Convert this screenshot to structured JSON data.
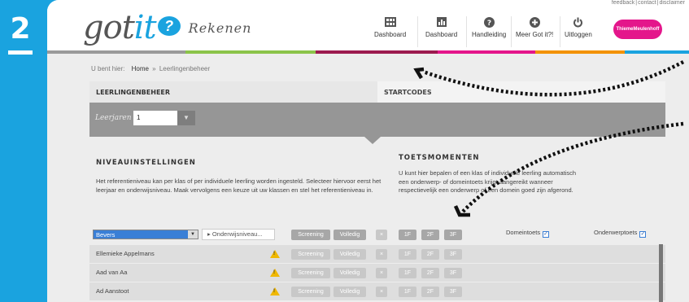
{
  "step": {
    "number": "2"
  },
  "app": {
    "logo_main": "got",
    "logo_it": "it",
    "logo_badge": "?",
    "logo_sub": "Rekenen",
    "publisher": "ThiemeMeulenhoff"
  },
  "toplinks": [
    "feedback",
    "contact",
    "disclaimer"
  ],
  "nav": [
    {
      "label": "Dashboard",
      "icon": "grid-icon"
    },
    {
      "label": "Dashboard",
      "icon": "chart-icon"
    },
    {
      "label": "Handleiding",
      "icon": "help-icon"
    },
    {
      "label": "Meer Got it?!",
      "icon": "plus-icon"
    },
    {
      "label": "Uitloggen",
      "icon": "power-icon"
    }
  ],
  "colors": {
    "accent": "#1aa3df",
    "bar": [
      "#9a9a9a",
      "#8bc34a",
      "#9c1a4f",
      "#e4168b",
      "#f39200",
      "#1aa3df"
    ]
  },
  "breadcrumb": {
    "prefix": "U bent hier:",
    "home": "Home",
    "separator": "»",
    "current": "Leerlingenbeheer"
  },
  "tabs": {
    "active": "LEERLINGENBEHEER",
    "inactive": "STARTCODES"
  },
  "filter": {
    "label": "Leerjaren",
    "value": "1"
  },
  "niveau": {
    "title": "NIVEAUINSTELLINGEN",
    "text": "Het referentieniveau kan per klas of per individuele leerling worden ingesteld. Selecteer hiervoor eerst het leerjaar en onderwijsniveau. Maak vervolgens een keuze uit uw klassen en stel het referentieniveau in."
  },
  "toets": {
    "title": "TOETSMOMENTEN",
    "text": "U kunt hier bepalen of een klas of individuele leerling automatisch een onderwerp- of domeintoets krijgt aangereikt wanneer respectievelijk een onderwerp of een domein goed zijn afgerond."
  },
  "controls": {
    "class_value": "Bevers",
    "level_label": "▸ Onderwijsniveau...",
    "screening": "Screening",
    "volledig": "Volledig",
    "clear": "×",
    "levels": [
      "1F",
      "2F",
      "3F"
    ],
    "domeintoets": "Domeintoets",
    "onderwerptoets": "Onderwerptoets",
    "checkmark": "✓"
  },
  "students": [
    {
      "name": "Ellemieke Appelmans"
    },
    {
      "name": "Aad van Aa"
    },
    {
      "name": "Ad Aanstoot"
    }
  ],
  "warning_mark": "!"
}
